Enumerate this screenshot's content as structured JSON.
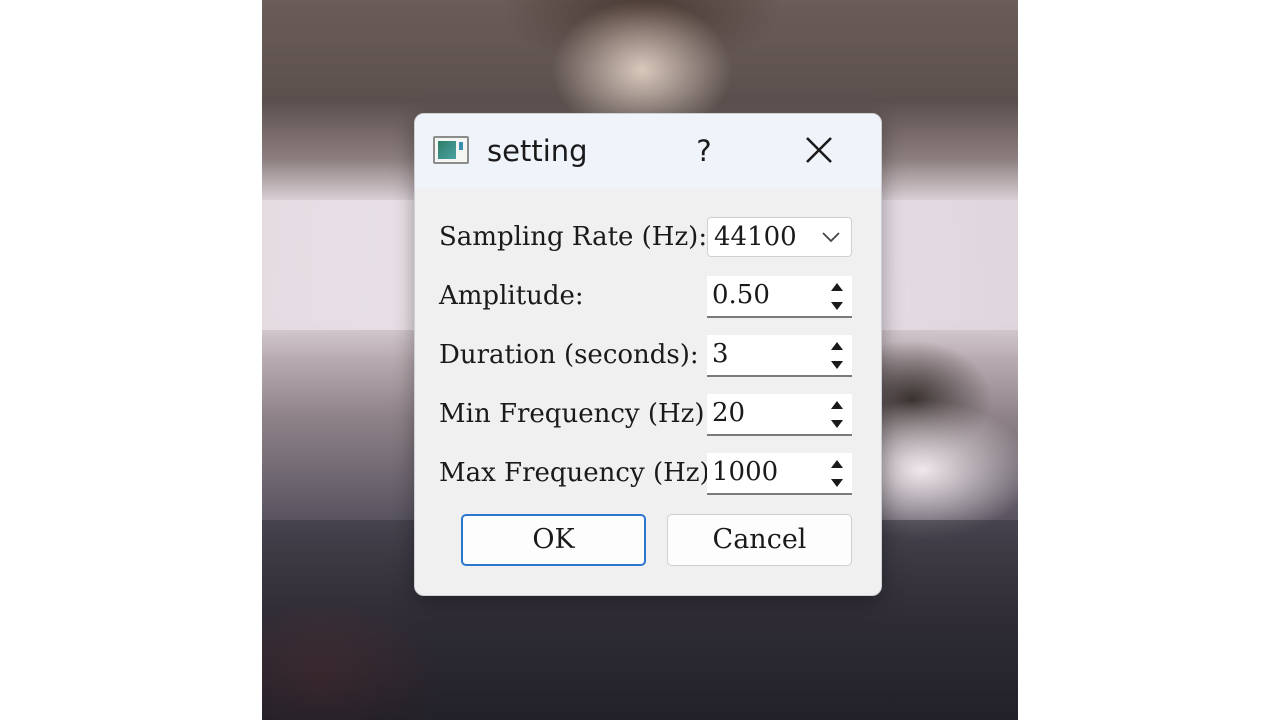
{
  "dialog": {
    "title": "setting",
    "help_label": "?",
    "icons": {
      "app": "app-window-icon",
      "close": "close-icon"
    }
  },
  "form": {
    "sampling_rate": {
      "label": "Sampling Rate (Hz):",
      "value": "44100"
    },
    "amplitude": {
      "label": "Amplitude:",
      "value": "0.50"
    },
    "duration": {
      "label": "Duration (seconds):",
      "value": "3"
    },
    "min_frequency": {
      "label": "Min Frequency (Hz):",
      "value": "20"
    },
    "max_frequency": {
      "label": "Max Frequency (Hz):",
      "value": "1000"
    }
  },
  "buttons": {
    "ok": "OK",
    "cancel": "Cancel"
  },
  "colors": {
    "accent": "#2a78d0",
    "titlebar": "#eff3fa",
    "dialog_bg": "#f0f0f0"
  }
}
